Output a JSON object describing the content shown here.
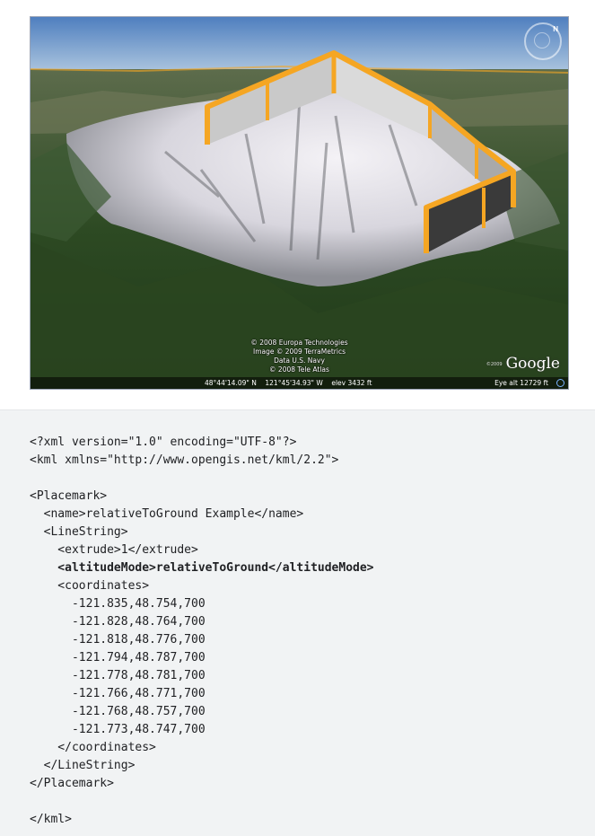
{
  "image": {
    "attribution": [
      "© 2008 Europa Technologies",
      "Image © 2009 TerraMetrics",
      "Data U.S. Navy",
      "© 2008 Tele Atlas"
    ],
    "status": {
      "lat": "48°44'14.09\" N",
      "lon": "121°45'34.93\" W",
      "elev": "elev 3432 ft",
      "eye_alt": "Eye alt 12729 ft"
    },
    "logo": "Google",
    "logo_small": "©2009",
    "compass_label": "N",
    "colors": {
      "wall_outline": "#f5a623",
      "wall_face": "#c9c9c9"
    }
  },
  "code": {
    "lines": [
      {
        "indent": 0,
        "text": "<?xml version=\"1.0\" encoding=\"UTF-8\"?>",
        "bold": false
      },
      {
        "indent": 0,
        "text": "<kml xmlns=\"http://www.opengis.net/kml/2.2\">",
        "bold": false
      },
      {
        "indent": 0,
        "text": "",
        "bold": false
      },
      {
        "indent": 0,
        "text": "<Placemark>",
        "bold": false
      },
      {
        "indent": 1,
        "text": "<name>relativeToGround Example</name>",
        "bold": false
      },
      {
        "indent": 1,
        "text": "<LineString>",
        "bold": false
      },
      {
        "indent": 2,
        "text": "<extrude>1</extrude>",
        "bold": false
      },
      {
        "indent": 2,
        "text": "<altitudeMode>relativeToGround</altitudeMode>",
        "bold": true
      },
      {
        "indent": 2,
        "text": "<coordinates>",
        "bold": false
      },
      {
        "indent": 3,
        "text": "-121.835,48.754,700",
        "bold": false
      },
      {
        "indent": 3,
        "text": "-121.828,48.764,700",
        "bold": false
      },
      {
        "indent": 3,
        "text": "-121.818,48.776,700",
        "bold": false
      },
      {
        "indent": 3,
        "text": "-121.794,48.787,700",
        "bold": false
      },
      {
        "indent": 3,
        "text": "-121.778,48.781,700",
        "bold": false
      },
      {
        "indent": 3,
        "text": "-121.766,48.771,700",
        "bold": false
      },
      {
        "indent": 3,
        "text": "-121.768,48.757,700",
        "bold": false
      },
      {
        "indent": 3,
        "text": "-121.773,48.747,700",
        "bold": false
      },
      {
        "indent": 2,
        "text": "</coordinates>",
        "bold": false
      },
      {
        "indent": 1,
        "text": "</LineString>",
        "bold": false
      },
      {
        "indent": 0,
        "text": "</Placemark>",
        "bold": false
      },
      {
        "indent": 0,
        "text": "",
        "bold": false
      },
      {
        "indent": 0,
        "text": "</kml>",
        "bold": false
      }
    ]
  }
}
